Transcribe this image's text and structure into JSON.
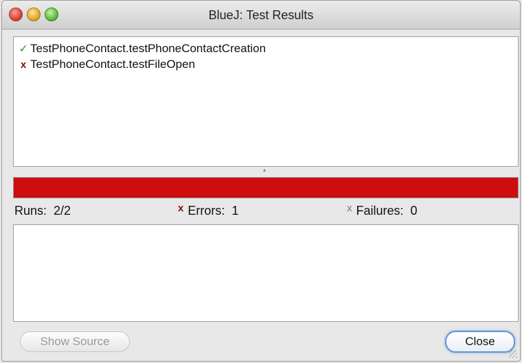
{
  "window": {
    "title": "BlueJ:  Test Results"
  },
  "results": [
    {
      "status": "pass",
      "icon": "checkmark-icon",
      "glyph": "✓",
      "label": "TestPhoneContact.testPhoneContactCreation"
    },
    {
      "status": "error",
      "icon": "error-x-icon",
      "glyph": "x",
      "label": "TestPhoneContact.testFileOpen"
    }
  ],
  "splitter": {
    "glyph": "▴"
  },
  "progress": {
    "fraction": 1.0,
    "color": "#cc0e0e"
  },
  "stats": {
    "runs_label": "Runs:",
    "runs_value": "2/2",
    "errors_icon_glyph": "x",
    "errors_label": "Errors:",
    "errors_value": "1",
    "failures_icon_glyph": "x",
    "failures_label": "Failures:",
    "failures_value": "0"
  },
  "buttons": {
    "show_source": "Show Source",
    "close": "Close"
  },
  "colors": {
    "error": "#8b0d0d",
    "pass": "#5fb048",
    "default_button_border": "#5d93d8"
  }
}
